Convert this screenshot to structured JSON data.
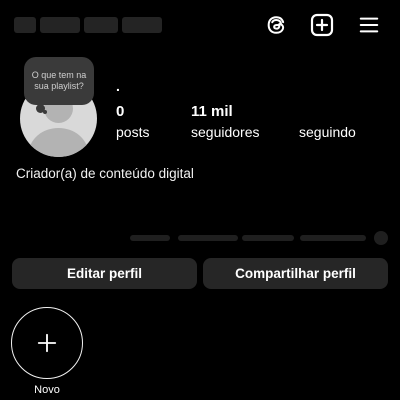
{
  "profile": {
    "display_name": ".",
    "note_text": "O que tem na sua playlist?",
    "bio": "Criador(a) de conteúdo digital"
  },
  "stats": {
    "posts_value": "0",
    "posts_label": "posts",
    "followers_value": "11 mil",
    "followers_label": "seguidores",
    "following_label": "seguindo"
  },
  "buttons": {
    "edit_profile": "Editar perfil",
    "share_profile": "Compartilhar perfil"
  },
  "highlights": {
    "new_label": "Novo"
  },
  "colors": {
    "background": "#000000",
    "button_bg": "#262626",
    "note_bg": "#3a3a3a",
    "avatar_bg": "#d9d9d9"
  },
  "icons": [
    "threads-icon",
    "add-icon",
    "menu-icon",
    "plus-icon"
  ]
}
